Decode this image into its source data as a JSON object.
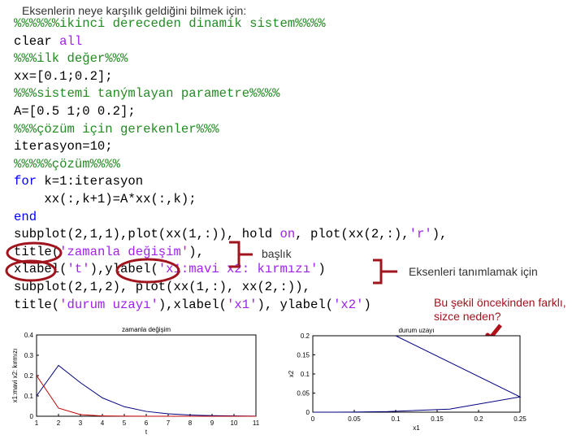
{
  "heading": "Eksenlerin neye karşılık geldiğini bilmek için:",
  "code_lines": [
    [
      {
        "t": "%%%%%%ikinci dereceden dinamik sistem%%%%",
        "c": "c"
      }
    ],
    [
      {
        "t": "clear ",
        "c": ""
      },
      {
        "t": "all",
        "c": "s"
      }
    ],
    [
      {
        "t": "%%%ilk değer%%%",
        "c": "c"
      }
    ],
    [
      {
        "t": "xx=[0.1;0.2];",
        "c": ""
      }
    ],
    [
      {
        "t": "%%%sistemi tanýmlayan parametre%%%%",
        "c": "c"
      }
    ],
    [
      {
        "t": "A=[0.5 1;0 0.2];",
        "c": ""
      }
    ],
    [
      {
        "t": "%%%çözüm için gerekenler%%%",
        "c": "c"
      }
    ],
    [
      {
        "t": "iterasyon=10;",
        "c": ""
      }
    ],
    [
      {
        "t": "%%%%%çözüm%%%%",
        "c": "c"
      }
    ],
    [
      {
        "t": "for",
        "c": "k"
      },
      {
        "t": " k=1:iterasyon",
        "c": ""
      }
    ],
    [
      {
        "t": "    xx(:,k+1)=A*xx(:,k);",
        "c": ""
      }
    ],
    [
      {
        "t": "end",
        "c": "k"
      }
    ],
    [
      {
        "t": "subplot(2,1,1),plot(xx(1,:)), hold ",
        "c": ""
      },
      {
        "t": "on",
        "c": "s"
      },
      {
        "t": ", plot(xx(2,:),",
        "c": ""
      },
      {
        "t": "'r'",
        "c": "s"
      },
      {
        "t": "),",
        "c": ""
      }
    ],
    [
      {
        "t": "title(",
        "c": ""
      },
      {
        "t": "'zamanla değişim'",
        "c": "s"
      },
      {
        "t": "),",
        "c": ""
      }
    ],
    [
      {
        "t": "xlabel(",
        "c": ""
      },
      {
        "t": "'t'",
        "c": "s"
      },
      {
        "t": "),ylabel(",
        "c": ""
      },
      {
        "t": "'x1:mavi x2: kırmızı'",
        "c": "s"
      },
      {
        "t": ")",
        "c": ""
      }
    ],
    [
      {
        "t": "subplot(2,1,2), plot(xx(1,:), xx(2,:)),",
        "c": ""
      }
    ],
    [
      {
        "t": "title(",
        "c": ""
      },
      {
        "t": "'durum uzayı'",
        "c": "s"
      },
      {
        "t": "),xlabel(",
        "c": ""
      },
      {
        "t": "'x1'",
        "c": "s"
      },
      {
        "t": "), ylabel(",
        "c": ""
      },
      {
        "t": "'x2'",
        "c": "s"
      },
      {
        "t": ")",
        "c": ""
      }
    ]
  ],
  "annotations": {
    "title_note": "başlık",
    "axes_note": "Eksenleri tanımlamak için",
    "question1": "Bu şekil öncekinden farklı,",
    "question2": "sizce neden?",
    "accent": "#a0141e"
  },
  "chart_data": [
    {
      "type": "line",
      "title": "zamanla değişim",
      "xlabel": "t",
      "ylabel": "x1:mavi x2: kırmızı",
      "xlim": [
        1,
        11
      ],
      "ylim": [
        0,
        0.4
      ],
      "xticks": [
        "1",
        "2",
        "3",
        "4",
        "5",
        "6",
        "7",
        "8",
        "9",
        "10",
        "11"
      ],
      "yticks": [
        "0",
        "0.1",
        "0.2",
        "0.3",
        "0.4"
      ],
      "x": [
        1,
        2,
        3,
        4,
        5,
        6,
        7,
        8,
        9,
        10,
        11
      ],
      "series": [
        {
          "color": "#00007f",
          "values": [
            0.1,
            0.25,
            0.165,
            0.0905,
            0.04685,
            0.02374,
            0.01194,
            0.00598,
            0.00299,
            0.0015,
            0.00075
          ]
        },
        {
          "color": "#c00000",
          "values": [
            0.2,
            0.04,
            0.008,
            0.0016,
            0.00032,
            6.4e-05,
            1.28e-05,
            2.6e-06,
            5e-07,
            1e-07,
            2e-08
          ]
        }
      ]
    },
    {
      "type": "line",
      "title": "durum uzayı",
      "xlabel": "x1",
      "ylabel": "x2",
      "xlim": [
        0,
        0.25
      ],
      "ylim": [
        0,
        0.2
      ],
      "xticks": [
        "0",
        "0.05",
        "0.1",
        "0.15",
        "0.2",
        "0.25"
      ],
      "yticks": [
        "0",
        "0.05",
        "0.1",
        "0.15",
        "0.2"
      ],
      "series": [
        {
          "color": "#00007f",
          "x": [
            0.1,
            0.25,
            0.165,
            0.0905,
            0.04685,
            0.02374,
            0.01194,
            0.00598,
            0.00299,
            0.0015,
            0.00075
          ],
          "y": [
            0.2,
            0.04,
            0.008,
            0.0016,
            0.00032,
            6.4e-05,
            1.28e-05,
            2.6e-06,
            5e-07,
            1e-07,
            2e-08
          ]
        }
      ]
    }
  ]
}
